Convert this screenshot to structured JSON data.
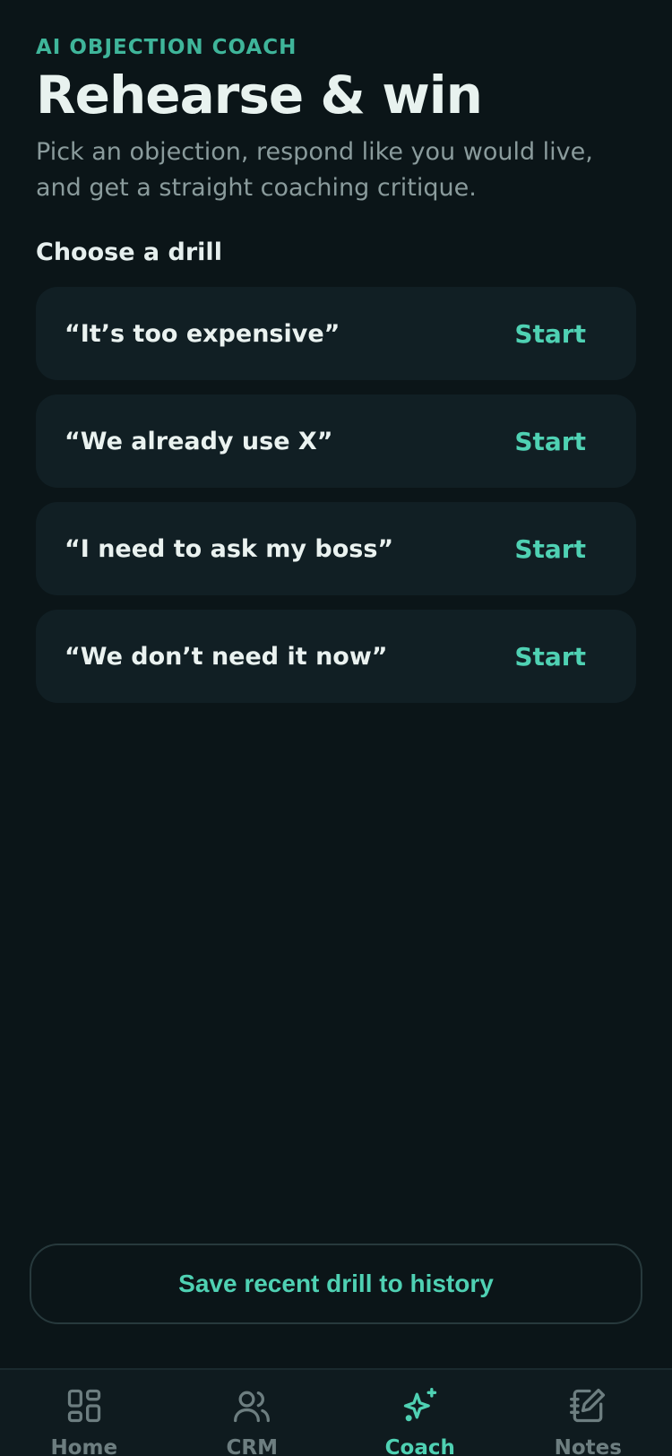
{
  "header": {
    "eyebrow": "AI OBJECTION COACH",
    "title": "Rehearse & win",
    "subtitle": "Pick an objection, respond like you would live, and get a straight coaching critique."
  },
  "drills": {
    "section_label": "Choose a drill",
    "start_label": "Start",
    "items": [
      {
        "text": "“It’s too expensive”"
      },
      {
        "text": "“We already use X”"
      },
      {
        "text": "“I need to ask my boss”"
      },
      {
        "text": "“We don’t need it now”"
      }
    ]
  },
  "actions": {
    "save_label": "Save recent drill to history"
  },
  "tabbar": {
    "tabs": [
      {
        "label": "Home",
        "icon": "grid-icon"
      },
      {
        "label": "CRM",
        "icon": "users-icon"
      },
      {
        "label": "Coach",
        "icon": "sparkles-icon",
        "active": true
      },
      {
        "label": "Notes",
        "icon": "notebook-icon"
      }
    ]
  },
  "colors": {
    "background": "#0b1518",
    "card": "#111f24",
    "accent": "#4fd1b3",
    "eyebrow": "#3fb59a",
    "muted": "#8a9b9c"
  }
}
